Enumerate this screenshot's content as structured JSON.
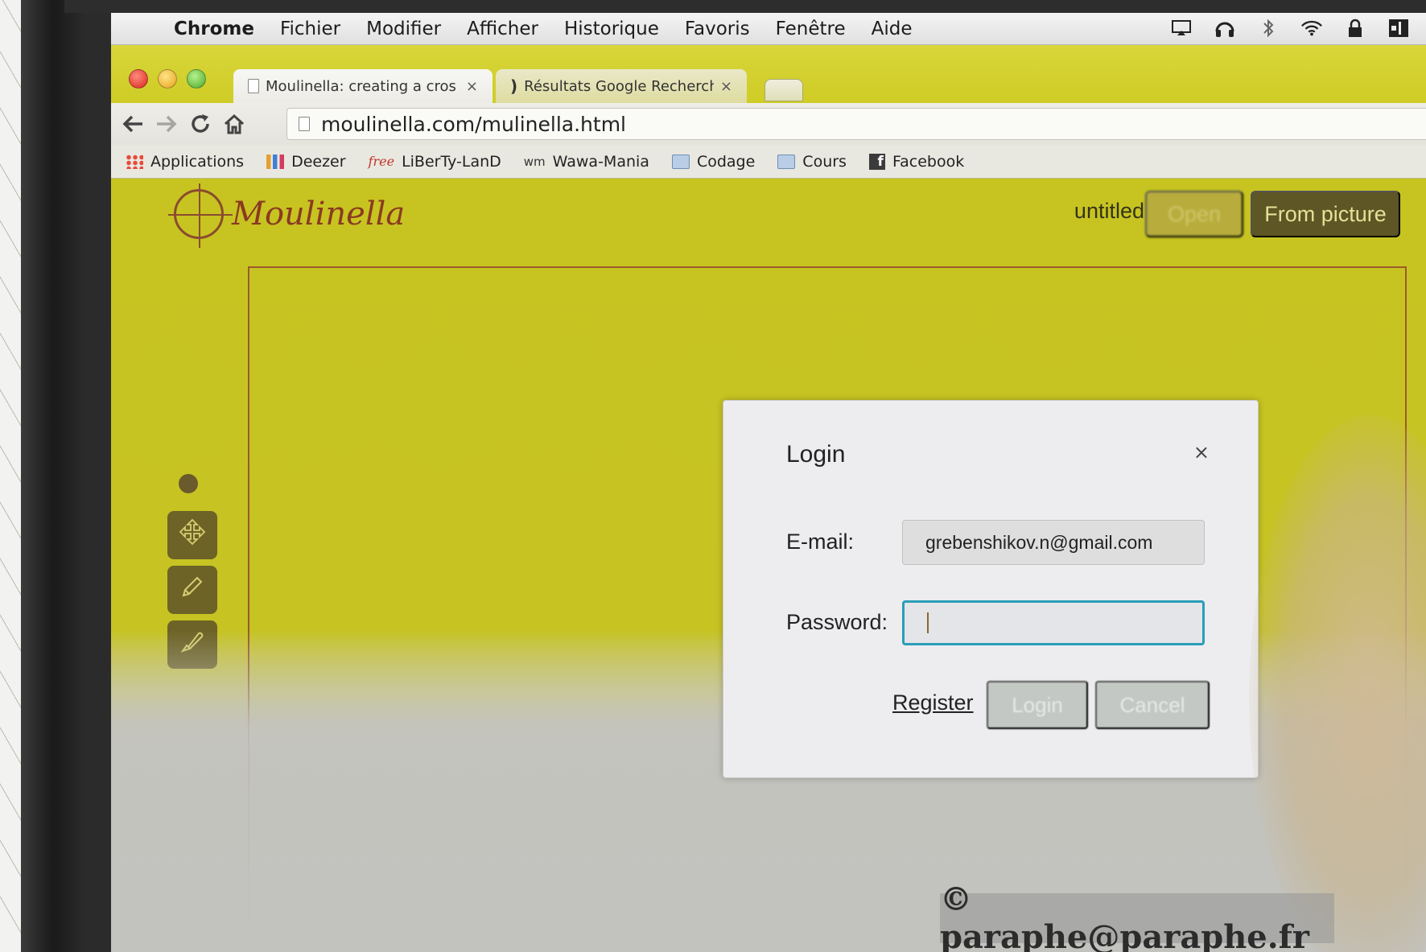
{
  "menubar": {
    "app_name": "Chrome",
    "items": [
      "Fichier",
      "Modifier",
      "Afficher",
      "Historique",
      "Favoris",
      "Fenêtre",
      "Aide"
    ]
  },
  "tabs": {
    "active_title": "Moulinella: creating a cros",
    "inactive_title": "Résultats Google Recherch",
    "close_glyph": "×"
  },
  "address_bar": {
    "url": "moulinella.com/mulinella.html"
  },
  "bookmarks": [
    "Applications",
    "Deezer",
    "LiBerTy-LanD",
    "Wawa-Mania",
    "Codage",
    "Cours",
    "Facebook"
  ],
  "app": {
    "logo_text": "Moulinella",
    "document_name": "untitled",
    "open_button": "Open",
    "from_picture_button": "From picture"
  },
  "login_dialog": {
    "title": "Login",
    "close_glyph": "×",
    "email_label": "E-mail:",
    "email_value": "grebenshikov.n@gmail.com",
    "password_label": "Password:",
    "password_value": "",
    "register_link": "Register",
    "login_button": "Login",
    "cancel_button": "Cancel"
  },
  "watermark": "© paraphe@paraphe.fr",
  "colors": {
    "app_background": "#c5c21c",
    "primary_button": "#5e5624",
    "focus_border": "#2a9db8"
  },
  "icons": [
    "apple-icon",
    "airplay-icon",
    "headphones-icon",
    "bluetooth-icon",
    "wifi-icon",
    "lock-icon",
    "user-icon",
    "back-icon",
    "forward-icon",
    "reload-icon",
    "home-icon",
    "page-icon",
    "move-tool-icon",
    "pencil-tool-icon",
    "brush-tool-icon"
  ]
}
